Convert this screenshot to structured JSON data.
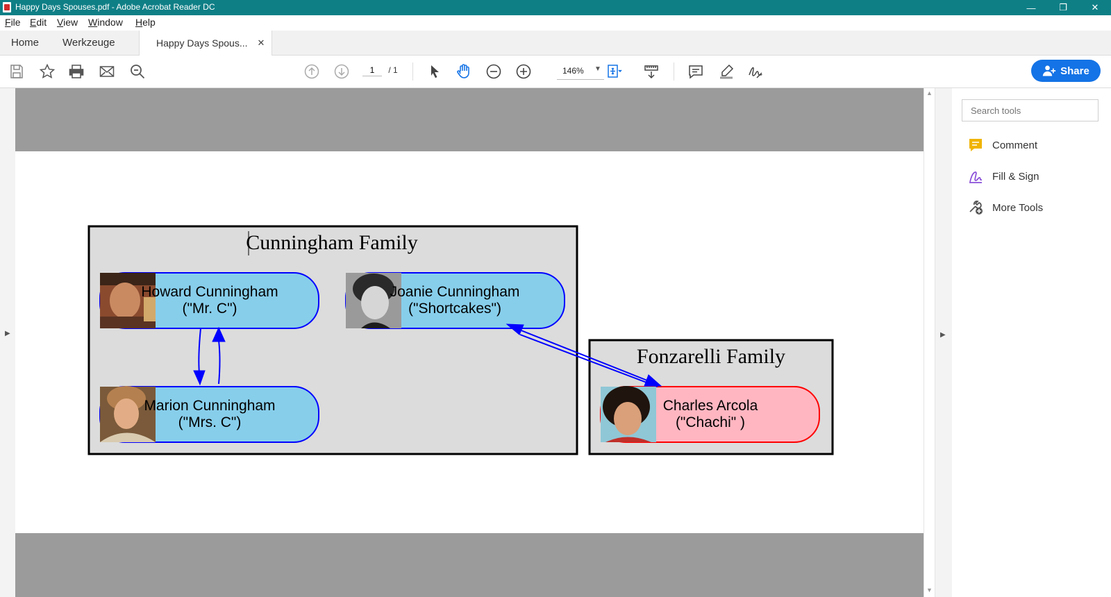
{
  "window": {
    "title": "Happy Days Spouses.pdf - Adobe Acrobat Reader DC",
    "controls": {
      "minimize": "—",
      "restore": "❐",
      "close": "✕"
    }
  },
  "menu": {
    "items": [
      "File",
      "Edit",
      "View",
      "Window",
      "Help"
    ],
    "accelerators": [
      "F",
      "E",
      "V",
      "W",
      "H"
    ]
  },
  "tabs": {
    "home": "Home",
    "tools": "Werkzeuge",
    "document": "Happy Days Spous...",
    "close": "✕"
  },
  "toolbar": {
    "page_current": "1",
    "page_total": "/ 1",
    "zoom": "146%",
    "share_label": "Share",
    "icons": [
      "save-icon",
      "star-icon",
      "print-icon",
      "mail-icon",
      "find-icon",
      "page-up-icon",
      "page-down-icon",
      "select-cursor-icon",
      "hand-icon",
      "zoom-out-icon",
      "zoom-in-icon",
      "fit-page-icon",
      "scroll-mode-icon",
      "comment-icon",
      "highlight-pen-icon",
      "sign-icon"
    ]
  },
  "right_panel": {
    "search_placeholder": "Search tools",
    "tools": [
      {
        "label": "Comment",
        "icon": "comment-icon",
        "color": "#f0b400"
      },
      {
        "label": "Fill & Sign",
        "icon": "fill-sign-icon",
        "color": "#8a4fd8"
      },
      {
        "label": "More Tools",
        "icon": "more-tools-icon",
        "color": "#555555"
      }
    ]
  },
  "diagram": {
    "clusters": [
      {
        "label": "Cunningham Family"
      },
      {
        "label": "Fonzarelli Family"
      }
    ],
    "nodes": [
      {
        "name": "Howard Cunningham",
        "nickname": "(\"Mr. C\")",
        "color": "#87ceeb",
        "border": "#0000ff"
      },
      {
        "name": "Joanie Cunningham",
        "nickname": "(\"Shortcakes\")",
        "color": "#87ceeb",
        "border": "#0000ff"
      },
      {
        "name": "Marion Cunningham",
        "nickname": "(\"Mrs. C\")",
        "color": "#87ceeb",
        "border": "#0000ff"
      },
      {
        "name": "Charles Arcola",
        "nickname": "(\"Chachi\" )",
        "color": "#ffb6c1",
        "border": "#ff0000"
      }
    ],
    "edge_color": "#0000ff",
    "cluster_fill": "#dcdcdc"
  }
}
